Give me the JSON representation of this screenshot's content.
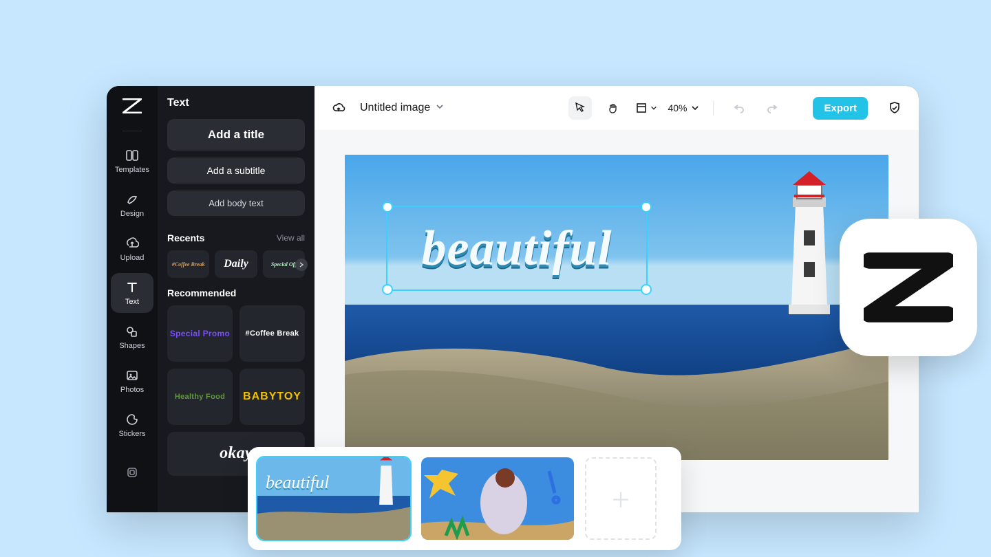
{
  "rail": {
    "items": [
      {
        "label": "Templates",
        "icon": "templates-icon"
      },
      {
        "label": "Design",
        "icon": "design-icon"
      },
      {
        "label": "Upload",
        "icon": "upload-icon"
      },
      {
        "label": "Text",
        "icon": "text-icon"
      },
      {
        "label": "Shapes",
        "icon": "shapes-icon"
      },
      {
        "label": "Photos",
        "icon": "photos-icon"
      },
      {
        "label": "Stickers",
        "icon": "stickers-icon"
      }
    ],
    "active_index": 3
  },
  "panel": {
    "title": "Text",
    "add_title_label": "Add a title",
    "add_subtitle_label": "Add a subtitle",
    "add_body_label": "Add body text",
    "recents_label": "Recents",
    "view_all_label": "View all",
    "recents": [
      {
        "text": "#Coffee Break"
      },
      {
        "text": "Daily"
      },
      {
        "text": "Special Off"
      }
    ],
    "recommended_label": "Recommended",
    "recommended": [
      {
        "text": "Special Promo",
        "style": "t-promo"
      },
      {
        "text": "#Coffee Break",
        "style": "t-coffee"
      },
      {
        "text": "Healthy Food",
        "style": "t-health"
      },
      {
        "text": "BABYTOY",
        "style": "t-baby"
      }
    ],
    "overflow_preview": "okay"
  },
  "topbar": {
    "doc_title": "Untitled image",
    "zoom_label": "40%",
    "export_label": "Export"
  },
  "canvas": {
    "selected_text": "beautiful"
  },
  "strip": {
    "thumb1_caption": "beautiful"
  }
}
